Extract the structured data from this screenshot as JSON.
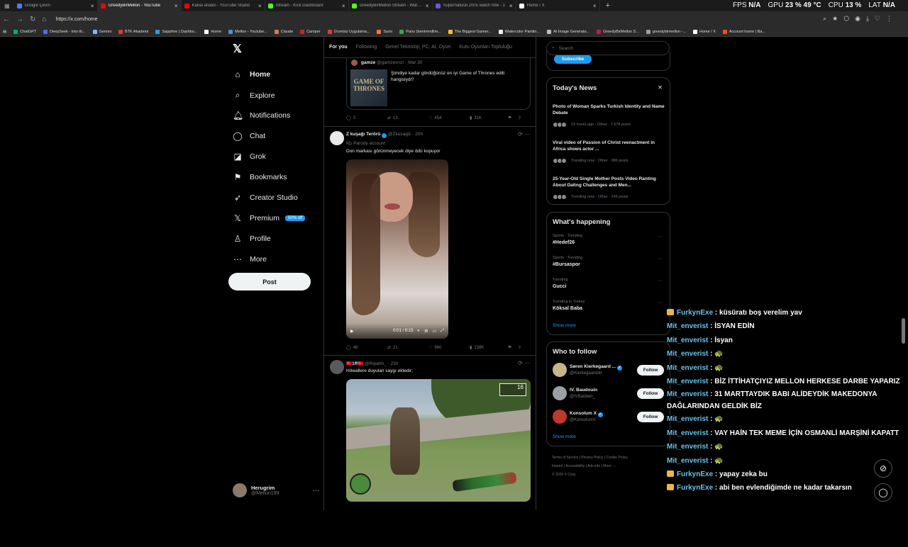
{
  "browser": {
    "tabs": [
      {
        "label": "Google Çeviri",
        "color": "#4285f4",
        "active": false
      },
      {
        "label": "GreedyBirMellon - YouTube",
        "color": "#ff0000",
        "active": true
      },
      {
        "label": "Kanal analizi - YouTube Studio",
        "color": "#ff0000",
        "active": false
      },
      {
        "label": "Stream - Kick Dashboard",
        "color": "#53fc18",
        "active": false
      },
      {
        "label": "GreedyBirMellon Stream - Watch -",
        "color": "#53fc18",
        "active": false
      },
      {
        "label": "Supernatural 2005 watch free - 1",
        "color": "#6a5acd",
        "active": false
      },
      {
        "label": "Home / X",
        "color": "#ffffff",
        "active": false
      }
    ],
    "new_tab": "+",
    "url": "https://x.com/home",
    "hud": {
      "fps_label": "FPS",
      "fps_value": "N/A",
      "gpu_label": "GPU",
      "gpu_value": "23 % 49 °C",
      "cpu_label": "CPU",
      "cpu_value": "13 %",
      "lat_label": "LAT",
      "lat_value": "N/A"
    },
    "bookmarks": [
      {
        "label": "ChatGPT",
        "color": "#10a37f"
      },
      {
        "label": "DeepSeek - Into th...",
        "color": "#4d6bfe"
      },
      {
        "label": "Gemini",
        "color": "#8ab4f8"
      },
      {
        "label": "BTK Akademi",
        "color": "#e23b2e"
      },
      {
        "label": "Sapphire | Dashbo...",
        "color": "#2d9cdb"
      },
      {
        "label": "Home",
        "color": "#ffffff"
      },
      {
        "label": "Mellon - Youtube...",
        "color": "#4a90d9"
      },
      {
        "label": "Claude",
        "color": "#d97757"
      },
      {
        "label": "Camper",
        "color": "#c62828"
      },
      {
        "label": "Ücretsiz Uygulama...",
        "color": "#e53935"
      },
      {
        "label": "Suno",
        "color": "#ff7043"
      },
      {
        "label": "Pano (bentrendlim...",
        "color": "#43a047"
      },
      {
        "label": "The Biggest Gamer...",
        "color": "#fbc02d"
      },
      {
        "label": "Watercolor Paintin...",
        "color": "#eeeeee"
      },
      {
        "label": "AI Image Generato...",
        "color": "#bdbdbd"
      },
      {
        "label": "GreedyBirMellon S...",
        "color": "#c2185b"
      },
      {
        "label": "greedybirmellon -...",
        "color": "#9e9e9e"
      },
      {
        "label": "Home / X",
        "color": "#ffffff"
      },
      {
        "label": "Account home | Ba...",
        "color": "#f4511e"
      }
    ]
  },
  "nav": {
    "logo": "𝕏",
    "items": [
      {
        "label": "Home",
        "icon": "⌂",
        "active": true
      },
      {
        "label": "Explore",
        "icon": "⌕"
      },
      {
        "label": "Notifications",
        "icon": "🔔︎"
      },
      {
        "label": "Chat",
        "icon": "◯"
      },
      {
        "label": "Grok",
        "icon": "◪"
      },
      {
        "label": "Bookmarks",
        "icon": "⚑"
      },
      {
        "label": "Creator Studio",
        "icon": "➶"
      },
      {
        "label": "Premium",
        "icon": "𝕏"
      },
      {
        "label": "Profile",
        "icon": "♙"
      },
      {
        "label": "More",
        "icon": "⋯"
      }
    ],
    "premium_badge": "50% off",
    "post": "Post",
    "account": {
      "name": "Herugrim",
      "handle": "@Mellon199",
      "more": "···"
    }
  },
  "feed": {
    "tabs": [
      "For you",
      "Following",
      "Genel Teknoloji, PC, AI, Oyun",
      "Kutu Oyunları Topluluğu"
    ],
    "quote": {
      "name": "gamze",
      "handle": "@gamzevrcn · Mar 30",
      "text": "Şimdiye kadar gördüğünüz en iyi Game of Thrones editi hangisiydi?",
      "img_text": "GAME OF THRONES"
    },
    "post1_actions": {
      "reply": "3",
      "repost": "13",
      "like": "454",
      "views": "31K"
    },
    "post2": {
      "name": "Z kuşağı Terörü",
      "handle": "@Zkusagiz · 20h",
      "parody": "Parody account",
      "text": "Don markası görünmeyecek diye ödü kopuyor",
      "video_time": "0:01 / 0:15",
      "actions": {
        "reply": "48",
        "repost": "21",
        "like": "960",
        "views": "138K"
      }
    },
    "post3": {
      "name": "🇹🇷1ff🇹🇷",
      "handle": "@Ripahh_ · 23h",
      "text": "Höwallere duyulan saygı ektedir;",
      "hud": "16"
    }
  },
  "right": {
    "search_placeholder": "Search",
    "subscribe": "Subscribe",
    "news_title": "Today's News",
    "news_close": "✕",
    "news": [
      {
        "title": "Photo of Woman Sparks Turkish Identity and Name Debate",
        "meta": "23 hours ago · Other · 7,578 posts"
      },
      {
        "title": "Viral video of Passion of Christ reenactment in Africa shows actor ...",
        "meta": "Trending now · Other · 986 posts"
      },
      {
        "title": "25-Year-Old Single Mother Posts Video Ranting About Dating Challenges and Men...",
        "meta": "Trending now · Other · 245 posts"
      }
    ],
    "happening_title": "What's happening",
    "trends": [
      {
        "label": "Sports · Trending",
        "title": "#Hedef26"
      },
      {
        "label": "Sports · Trending",
        "title": "#Bursaspor"
      },
      {
        "label": "Trending",
        "title": "Gucci"
      },
      {
        "label": "Trending in Turkey",
        "title": "Köksal Baba"
      }
    ],
    "show_more": "Show more",
    "wtf_title": "Who to follow",
    "wtf": [
      {
        "name": "Søren Kierkegaard ...",
        "handle": "@Kierkegaarddd",
        "verified": true,
        "color": "#c8b48a"
      },
      {
        "name": "IV. Baudouin",
        "handle": "@IVBaldwin_",
        "verified": false,
        "color": "#9aa0a6"
      },
      {
        "name": "Konsolum X",
        "handle": "@KonsolumX",
        "verified": true,
        "color": "#c0392b"
      }
    ],
    "follow": "Follow",
    "footer": [
      "Terms of Service",
      "Privacy Policy",
      "Cookie Policy",
      "Imprint",
      "Accessibility",
      "Ads info",
      "More ···",
      "© 2026 X Corp."
    ]
  },
  "chat": [
    {
      "user": "FurkynExe",
      "badge": true,
      "msg": "küsüratı boş verelim yav"
    },
    {
      "user": "Mit_enverist",
      "badge": false,
      "msg": "İSYAN EDİN"
    },
    {
      "user": "Mit_enverist",
      "badge": false,
      "msg": "İsyan"
    },
    {
      "user": "Mit_enverist",
      "badge": false,
      "msg": "🐢"
    },
    {
      "user": "Mit_enverist",
      "badge": false,
      "msg": "🐢"
    },
    {
      "user": "Mit_enverist",
      "badge": false,
      "msg": "BİZ İTTİHATÇIYIZ MELLON HERKESE DARBE YAPARIZ"
    },
    {
      "user": "Mit_enverist",
      "badge": false,
      "msg": "31 MARTTAYDIK BABI ALİDEYDİK MAKEDONYA DAĞLARINDAN GELDİK BİZ"
    },
    {
      "user": "Mit_enverist",
      "badge": false,
      "msg": "🐢"
    },
    {
      "user": "Mit_enverist",
      "badge": false,
      "msg": "VAY HAİN TEK MEME İÇİN OSMANLİ MARŞİNİ KAPATT"
    },
    {
      "user": "Mit_enverist",
      "badge": false,
      "msg": "🐢"
    },
    {
      "user": "Mit_enverist",
      "badge": false,
      "msg": "🐢"
    },
    {
      "user": "FurkynExe",
      "badge": true,
      "msg": "yapay zeka bu"
    },
    {
      "user": "FurkynExe",
      "badge": true,
      "msg": "abi ben evlendiğimde ne kadar takarsın"
    }
  ]
}
